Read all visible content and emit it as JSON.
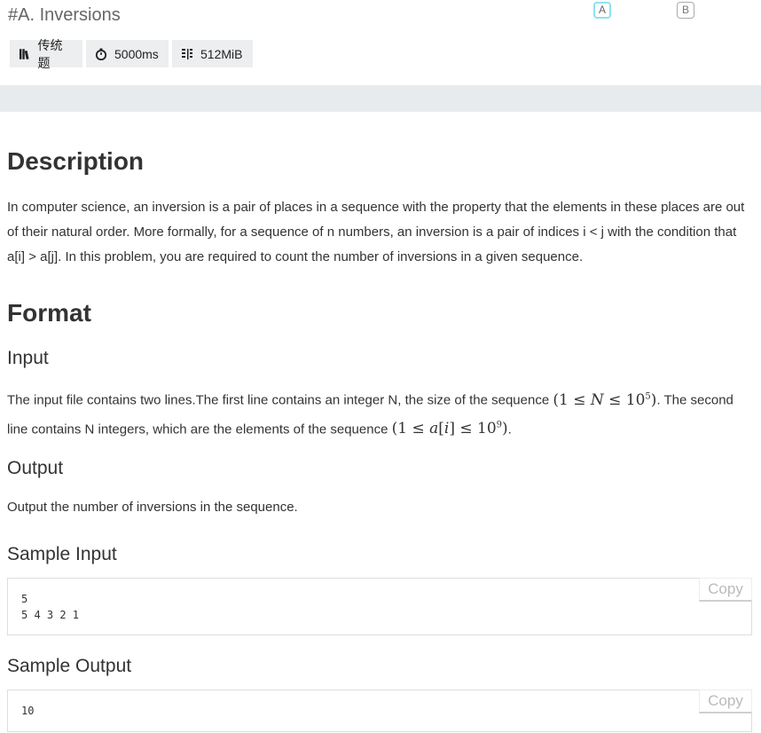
{
  "problem": {
    "title": "#A. Inversions",
    "tabs": [
      "A",
      "B"
    ],
    "tags": {
      "type": "传统题",
      "time": "5000ms",
      "memory": "512MiB"
    }
  },
  "description": {
    "heading": "Description",
    "text": "In computer science, an inversion is a pair of places in a sequence with the property that the elements in these places are out of their natural order. More formally, for a sequence of n numbers, an inversion is a pair of indices i < j with the condition that a[i] > a[j]. In this problem, you are required to count the number of inversions in a given sequence."
  },
  "format": {
    "heading": "Format",
    "input_heading": "Input",
    "input_text_1": "The input file contains two lines.The first line contains an integer N, the size of the sequence",
    "input_text_2": ". The second line contains N integers, which are the elements of the sequence",
    "input_text_3": ".",
    "output_heading": "Output",
    "output_text": "Output the number of inversions in the sequence."
  },
  "samples": {
    "input_heading": "Sample Input",
    "input_code": "5\n5 4 3 2 1",
    "output_heading": "Sample Output",
    "output_code": "10",
    "copy_label": "Copy"
  }
}
